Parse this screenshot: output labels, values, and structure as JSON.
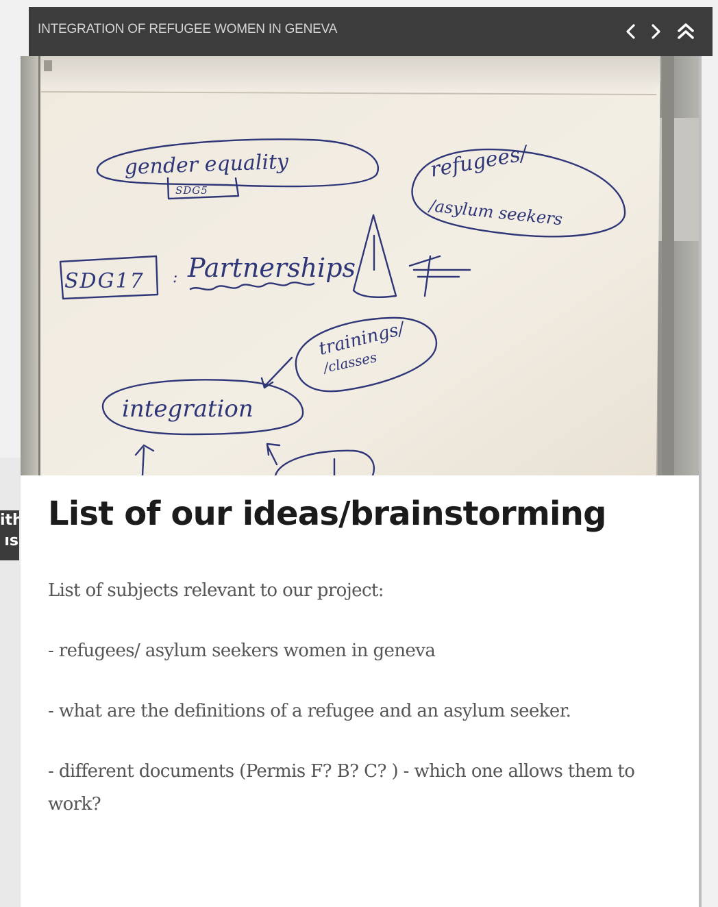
{
  "header": {
    "title": "INTEGRATION OF REFUGEE WOMEN IN GENEVA",
    "prev_icon": "chevron-left-icon",
    "next_icon": "chevron-right-icon",
    "top_icon": "double-chevron-up-icon"
  },
  "side_tab": {
    "line1": "ith",
    "line2": "ıs"
  },
  "photo": {
    "words": {
      "gender_equality": "gender equality",
      "sdg5": "SDG5",
      "refugees": "refugees/",
      "asylum_seekers": "/asylum seekers",
      "sdg17": "SDG17",
      "partnerships": "Partnerships",
      "trainings": "trainings/",
      "classes": "/classes",
      "integration": "integration"
    }
  },
  "content": {
    "heading": "List of our ideas/brainstorming",
    "paragraphs": [
      "List of subjects relevant to our project:",
      "- refugees/ asylum seekers women in geneva",
      "- what are the definitions of a refugee and an asylum seeker.",
      "- different documents (Permis F? B? C? ) - which one allows them to work?"
    ]
  },
  "colors": {
    "header_bg": "#3c3c3c",
    "header_text": "#d5d5d5",
    "heading_text": "#1b1b1b",
    "body_text": "#555555",
    "marker_ink": "#2f3678",
    "flipchart_paper": "#f4efe6"
  }
}
